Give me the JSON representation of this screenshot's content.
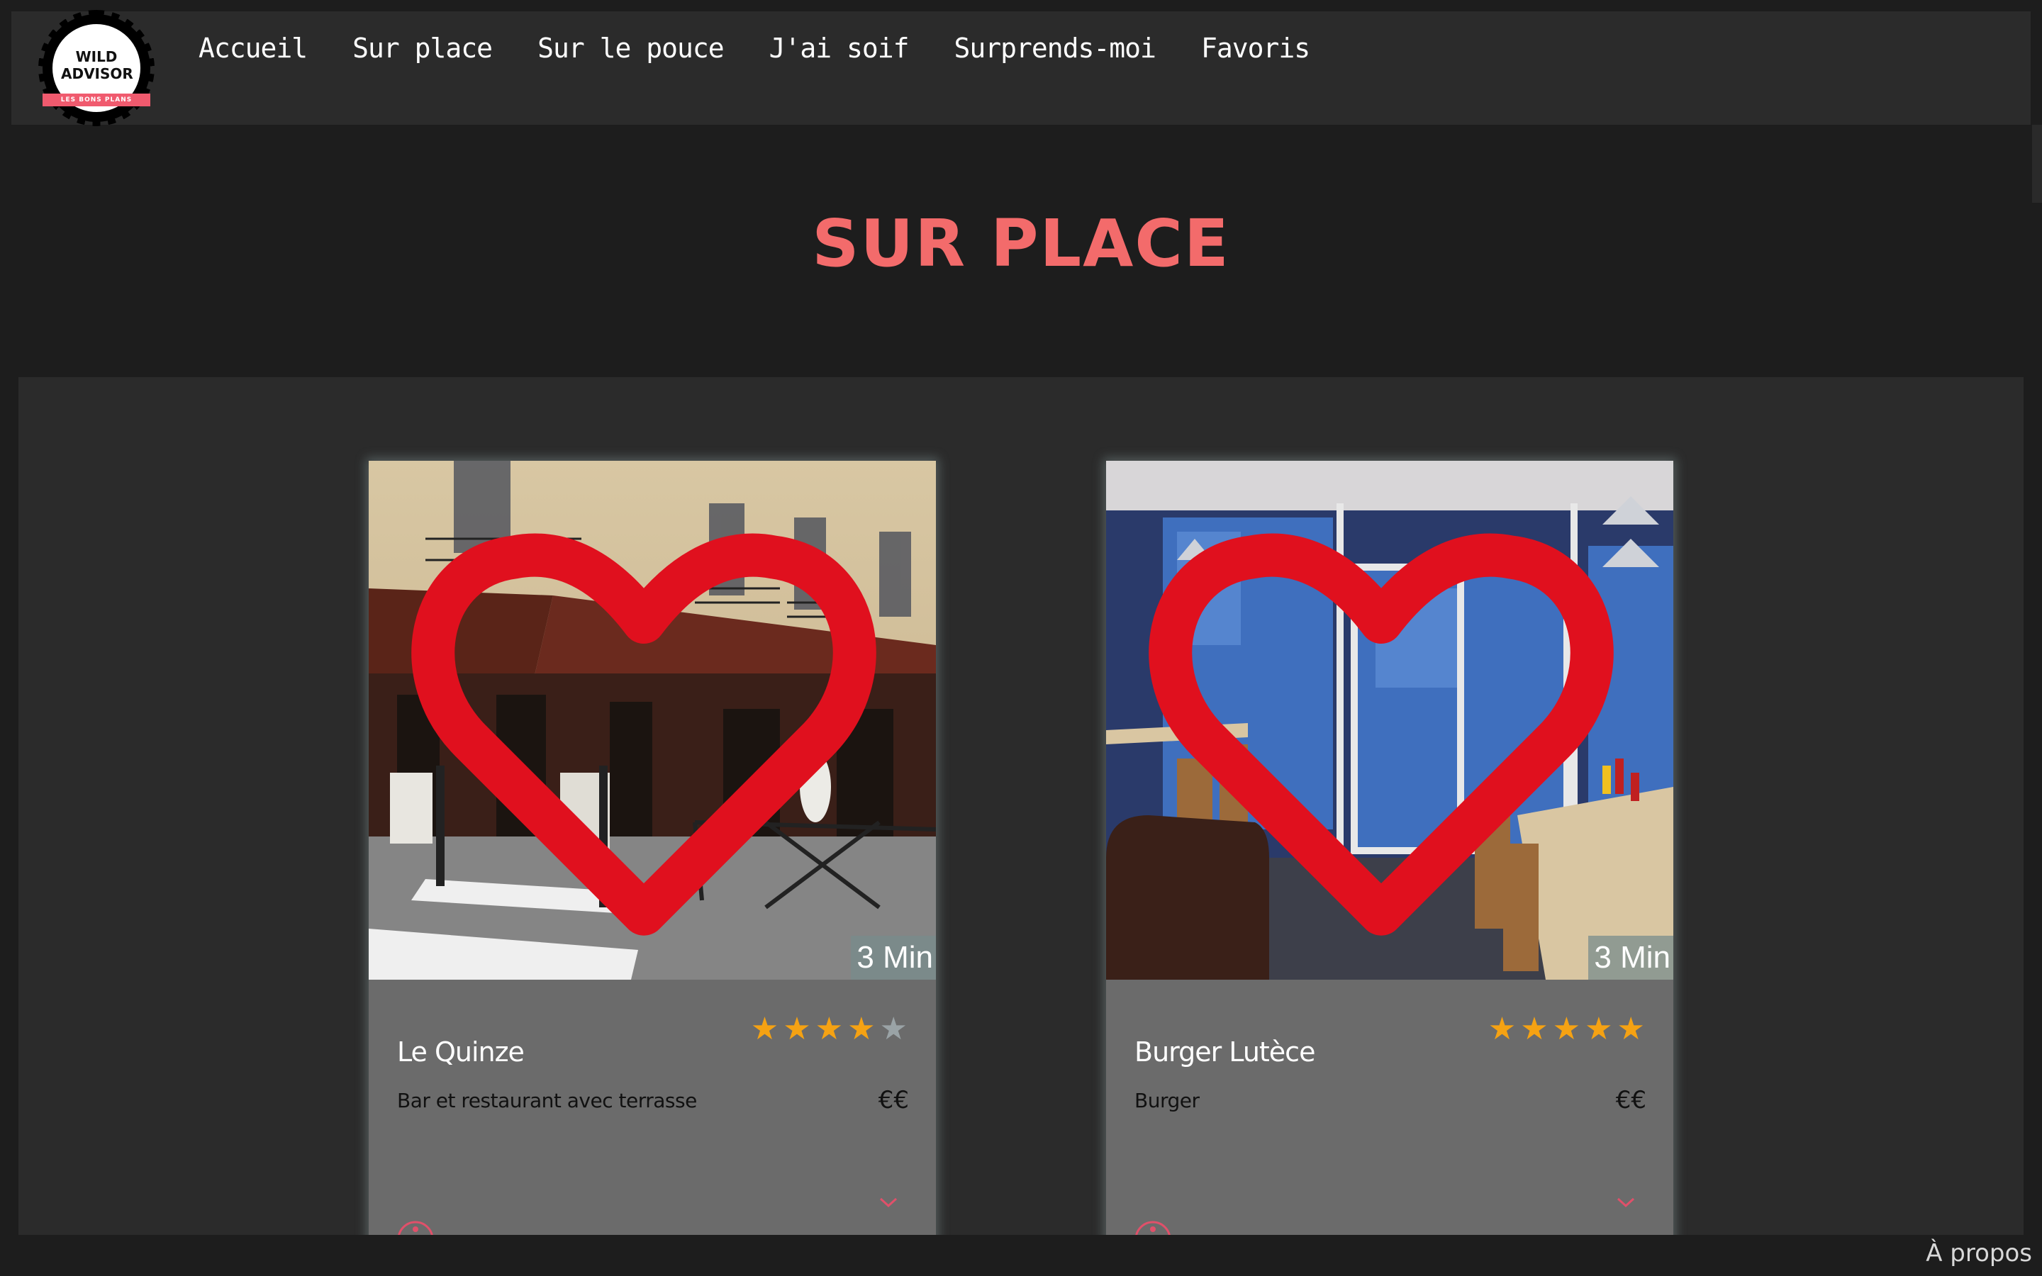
{
  "logo": {
    "line1": "WILD",
    "line2": "ADVISOR",
    "tagline": "LES BONS PLANS"
  },
  "nav": {
    "items": [
      {
        "label": "Accueil"
      },
      {
        "label": "Sur place"
      },
      {
        "label": "Sur le pouce"
      },
      {
        "label": "J'ai soif"
      },
      {
        "label": "Surprends-moi"
      },
      {
        "label": "Favoris"
      }
    ]
  },
  "page": {
    "title": "SUR PLACE"
  },
  "cards": [
    {
      "name": "Le Quinze",
      "description": "Bar et restaurant avec terrasse",
      "price": "€€",
      "time": "3 Min",
      "rating": 4,
      "rating_max": 5,
      "favorite_icon": "heart-outline-icon",
      "accent": "#f5a213"
    },
    {
      "name": "Burger Lutèce",
      "description": "Burger",
      "price": "€€",
      "time": "3 Min",
      "rating": 5,
      "rating_max": 5,
      "favorite_icon": "heart-outline-icon",
      "accent": "#f5a213"
    }
  ],
  "footer": {
    "about": "À propos"
  },
  "colors": {
    "title": "#f36b6b",
    "star_on": "#f5a213",
    "star_off": "#9aa3a6",
    "heart": "#e0101e",
    "icon_accent": "#e0506a"
  }
}
